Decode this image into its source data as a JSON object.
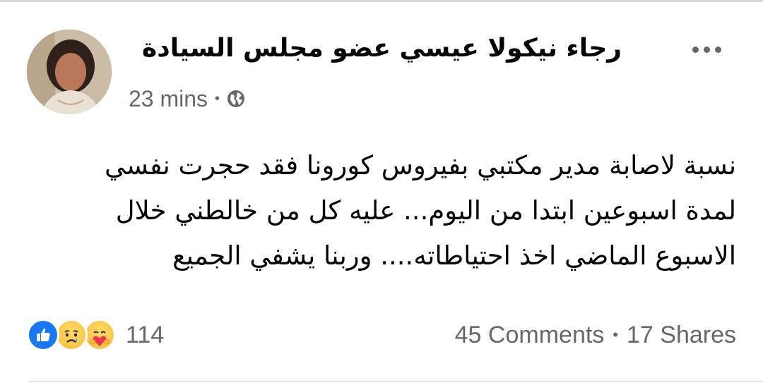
{
  "post": {
    "author_name": "رجاء نيكولا عيسي عضو مجلس السيادة",
    "timestamp": "23 mins",
    "separator": "•",
    "privacy_icon": "globe-icon",
    "more_icon": "more-options-icon",
    "text_lines": [
      "نسبة لاصابة مدير مكتبي بفيروس كورونا فقد حجرت نفسي",
      "لمدة اسبوعين ابتدا من اليوم... عليه كل من خالطني خلال",
      "الاسبوع الماضي اخذ احتياطاته.... وربنا يشفي الجميع"
    ]
  },
  "footer": {
    "reactions": [
      "like-icon",
      "sad-icon",
      "care-icon"
    ],
    "reaction_count": "114",
    "comments": "45 Comments",
    "separator": "•",
    "shares": "17 Shares"
  },
  "colors": {
    "like_blue": "#1877f2",
    "secondary_text": "#65676b",
    "primary_text": "#050505"
  }
}
